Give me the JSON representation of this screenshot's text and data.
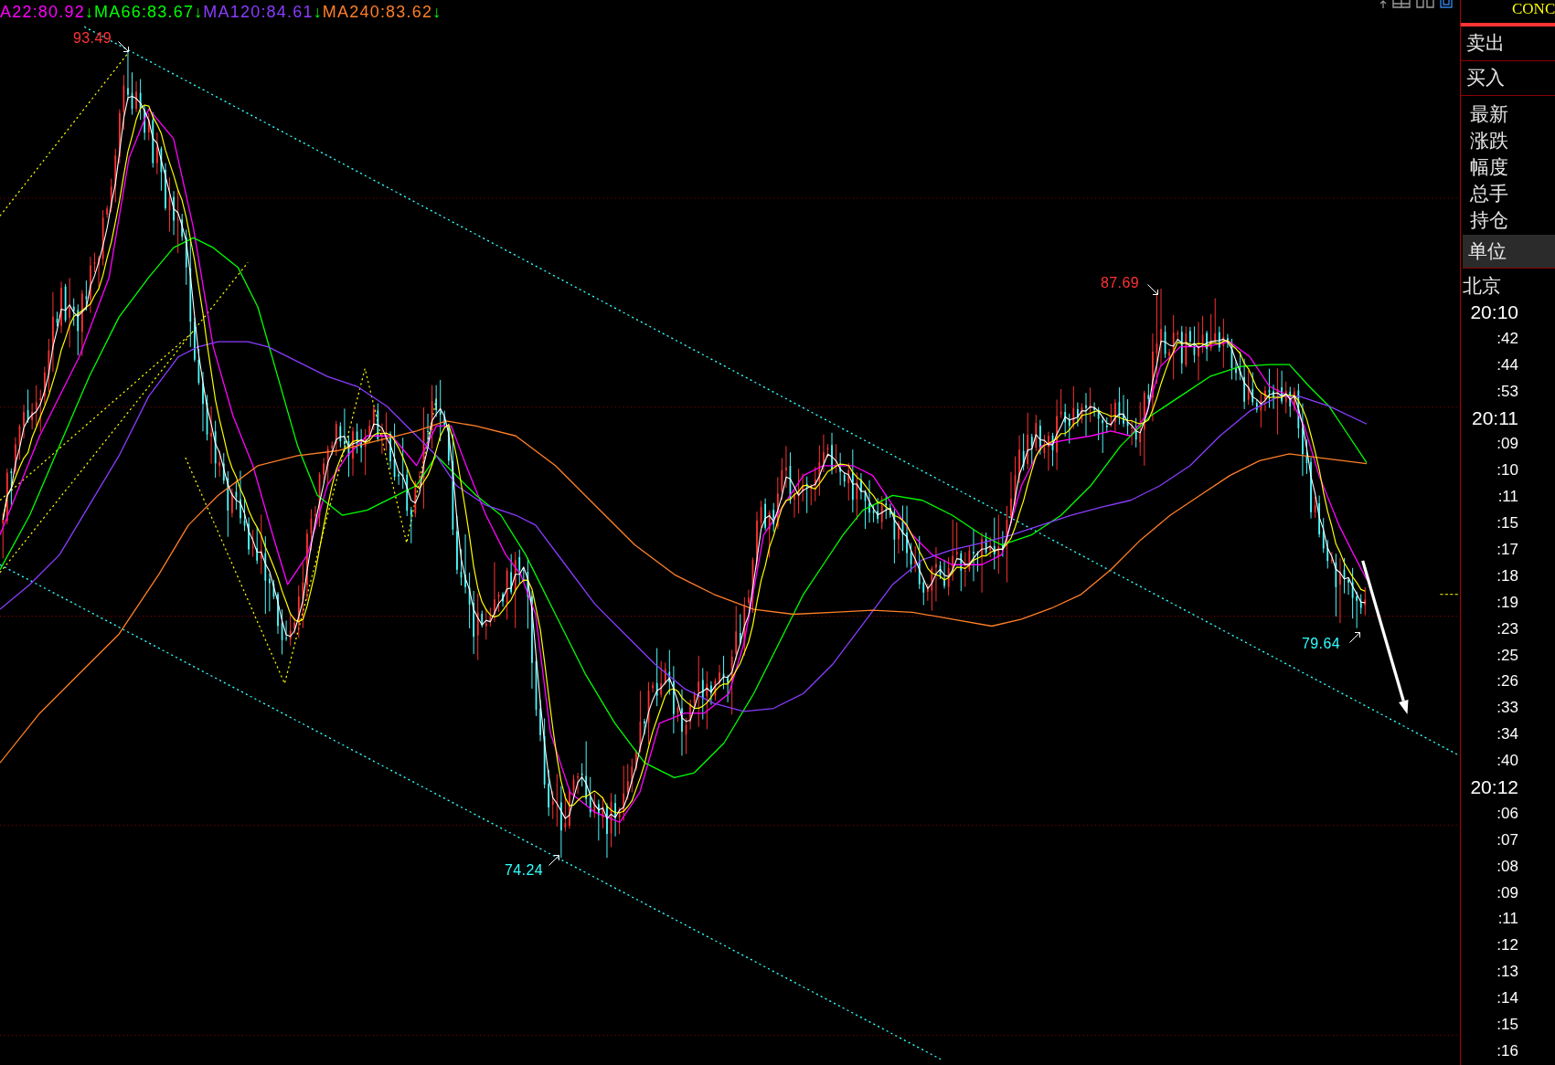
{
  "legend": [
    {
      "label": "A22:80.92",
      "color": "#ff00ff",
      "arrow": "↓"
    },
    {
      "label": "MA66:83.67",
      "color": "#00ff00",
      "arrow": "↓"
    },
    {
      "label": "MA120:84.61",
      "color": "#8a3cff",
      "arrow": "↓"
    },
    {
      "label": "MA240:83.62",
      "color": "#ff7f27",
      "arrow": "↓"
    }
  ],
  "price_labels": [
    {
      "text": "93.49",
      "kind": "high"
    },
    {
      "text": "74.24",
      "kind": "low"
    },
    {
      "text": "87.69",
      "kind": "high"
    },
    {
      "text": "79.64",
      "kind": "low"
    }
  ],
  "quote_panel": {
    "symbol": "CONC",
    "sell": "卖出",
    "buy": "买入",
    "fields": [
      "最新",
      "涨跌",
      "幅度",
      "总手",
      "持仓"
    ],
    "unit": "单位",
    "timezone": "北京",
    "times": [
      {
        "text": "20:10",
        "kind": "minute"
      },
      {
        "text": ":42",
        "kind": "second"
      },
      {
        "text": ":44",
        "kind": "second"
      },
      {
        "text": ":53",
        "kind": "second"
      },
      {
        "text": "20:11",
        "kind": "minute"
      },
      {
        "text": ":09",
        "kind": "second"
      },
      {
        "text": ":10",
        "kind": "second"
      },
      {
        "text": ":11",
        "kind": "second"
      },
      {
        "text": ":15",
        "kind": "second"
      },
      {
        "text": ":17",
        "kind": "second"
      },
      {
        "text": ":18",
        "kind": "second"
      },
      {
        "text": ":19",
        "kind": "second"
      },
      {
        "text": ":23",
        "kind": "second"
      },
      {
        "text": ":25",
        "kind": "second"
      },
      {
        "text": ":26",
        "kind": "second"
      },
      {
        "text": ":33",
        "kind": "second"
      },
      {
        "text": ":34",
        "kind": "second"
      },
      {
        "text": ":40",
        "kind": "second"
      },
      {
        "text": "20:12",
        "kind": "minute"
      },
      {
        "text": ":06",
        "kind": "second"
      },
      {
        "text": ":07",
        "kind": "second"
      },
      {
        "text": ":08",
        "kind": "second"
      },
      {
        "text": ":09",
        "kind": "second"
      },
      {
        "text": ":11",
        "kind": "second"
      },
      {
        "text": ":12",
        "kind": "second"
      },
      {
        "text": ":13",
        "kind": "second"
      },
      {
        "text": ":14",
        "kind": "second"
      },
      {
        "text": ":15",
        "kind": "second"
      },
      {
        "text": ":16",
        "kind": "second"
      }
    ]
  }
}
